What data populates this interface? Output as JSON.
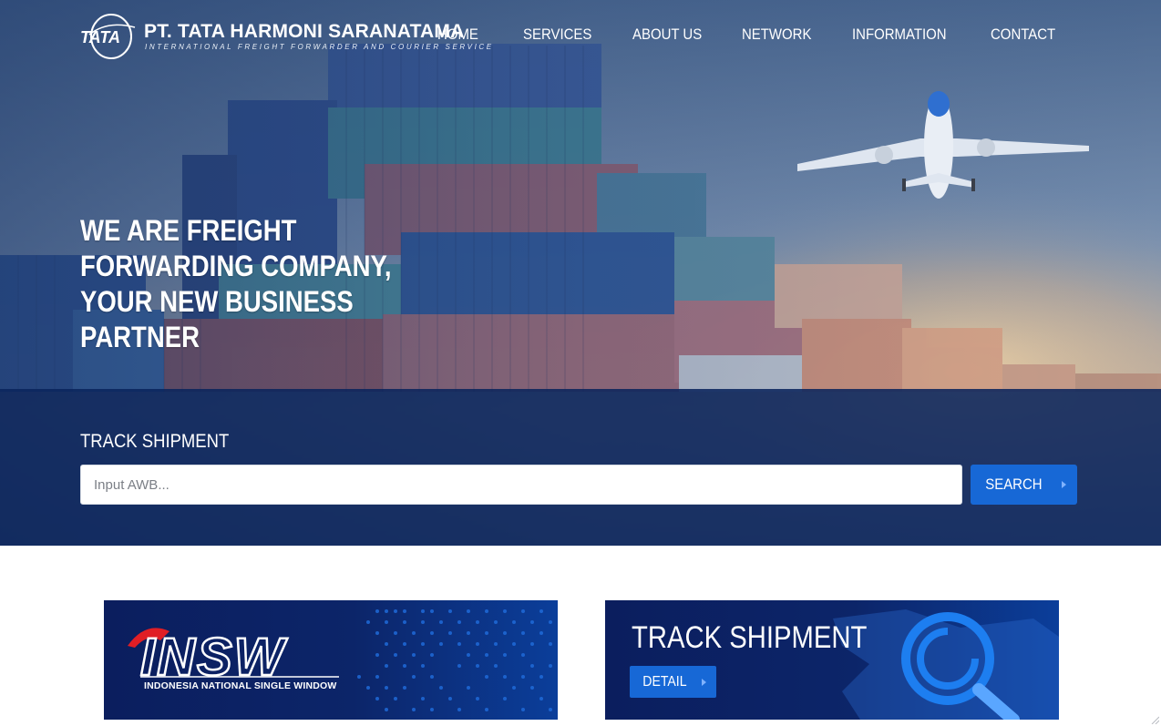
{
  "brand": {
    "mark": "TATA",
    "name": "PT. TATA HARMONI SARANATAMA",
    "tagline": "INTERNATIONAL FREIGHT FORWARDER AND COURIER SERVICE"
  },
  "nav": {
    "items": [
      "HOME",
      "SERVICES",
      "ABOUT US",
      "NETWORK",
      "INFORMATION",
      "CONTACT"
    ]
  },
  "hero": {
    "headline": "WE ARE FREIGHT FORWARDING COMPANY, YOUR NEW BUSINESS PARTNER"
  },
  "track": {
    "title": "TRACK SHIPMENT",
    "input_placeholder": "Input AWB...",
    "input_value": "",
    "search_label": "SEARCH"
  },
  "banners": {
    "insw": {
      "logo_text": "INSW",
      "subtitle": "INDONESIA NATIONAL SINGLE WINDOW"
    },
    "track": {
      "title": "TRACK SHIPMENT",
      "button_label": "DETAIL"
    }
  },
  "colors": {
    "accent": "#1768d6",
    "band": "#0a245c",
    "banner_bg": "#0b1e5e"
  },
  "icons": [
    "airplane-icon",
    "chevron-right-icon",
    "magnifier-icon",
    "world-map-icon"
  ]
}
